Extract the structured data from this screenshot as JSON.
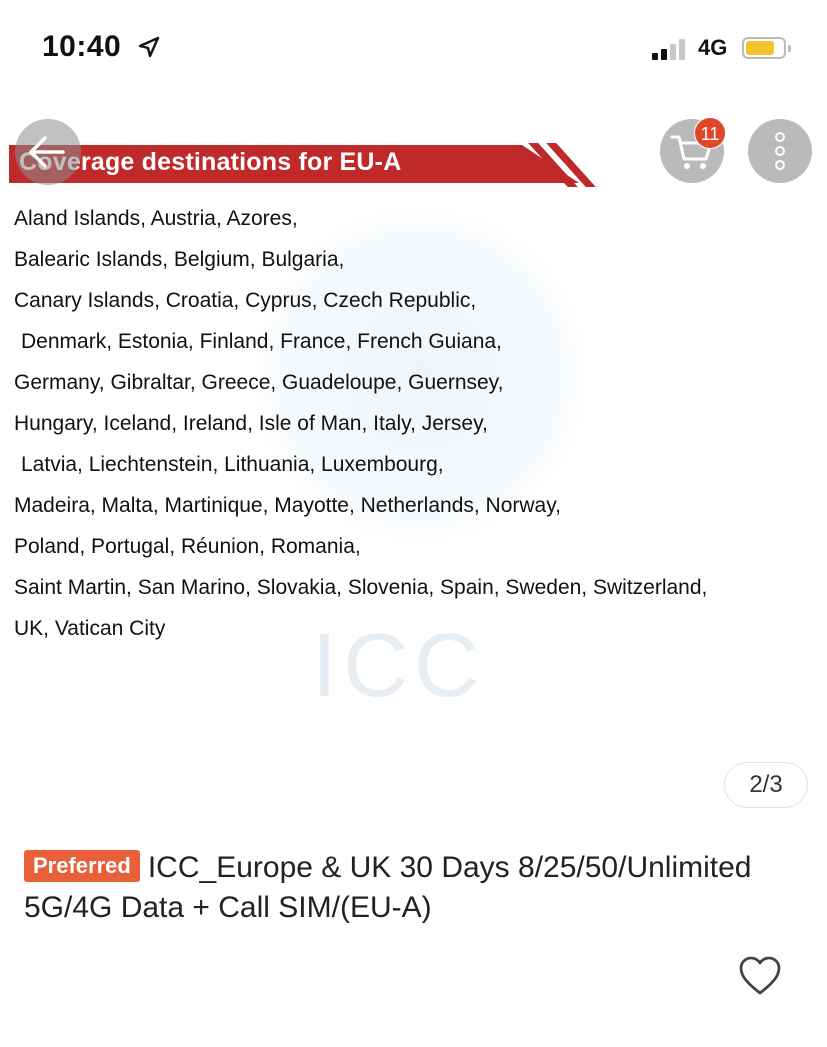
{
  "status_bar": {
    "time": "10:40",
    "network": "4G",
    "icons": [
      "location-arrow-icon",
      "signal-icon",
      "battery-icon"
    ],
    "battery_color": "#f4c430"
  },
  "product_image": {
    "banner_title": "Coverage destinations for EU-A",
    "banner_color": "#c0292a",
    "country_lines": [
      "Aland Islands, Austria, Azores,",
      "Balearic Islands, Belgium, Bulgaria,",
      "Canary Islands, Croatia, Cyprus, Czech Republic,",
      "Denmark, Estonia, Finland, France, French Guiana,",
      "Germany, Gibraltar, Greece, Guadeloupe, Guernsey,",
      "Hungary, Iceland, Ireland, Isle of Man, Italy, Jersey,",
      "Latvia, Liechtenstein, Lithuania, Luxembourg,",
      "Madeira, Malta, Martinique, Mayotte, Netherlands, Norway,",
      "Poland, Portugal, Réunion, Romania,",
      "Saint Martin, San Marino, Slovakia, Slovenia, Spain, Sweden, Switzerland,",
      "UK, Vatican City"
    ],
    "watermark_text": "ICC",
    "page_indicator": "2/3"
  },
  "nav": {
    "back_icon": "back-arrow-icon",
    "cart_icon": "shopping-cart-icon",
    "cart_count": "11",
    "more_icon": "more-vertical-icon"
  },
  "product": {
    "badge": "Preferred",
    "badge_color": "#e85f3a",
    "title": "ICC_Europe & UK 30 Days 8/25/50/Unlimited 5G/4G Data + Call SIM/(EU-A)",
    "favorite_icon": "heart-icon"
  }
}
